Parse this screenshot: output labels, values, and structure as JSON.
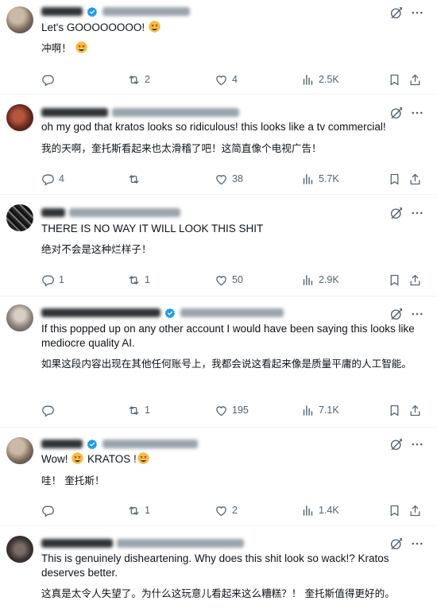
{
  "replies": [
    {
      "text_en": "Let's GOOOOOOOO! ",
      "text_zh": "冲啊！ ",
      "emoji": [
        "star-struck"
      ],
      "reply_count": "",
      "repost_count": "2",
      "like_count": "4",
      "view_count": "2.5K"
    },
    {
      "text_en": "oh my god that kratos looks so ridiculous! this looks like a tv commercial!",
      "text_zh": "我的天啊，奎托斯看起来也太滑稽了吧！这简直像个电视广告！",
      "reply_count": "4",
      "repost_count": "",
      "like_count": "38",
      "view_count": "5.7K"
    },
    {
      "text_en": "THERE IS NO WAY IT WILL LOOK THIS SHIT",
      "text_zh": "绝对不会是这种烂样子！",
      "reply_count": "1",
      "repost_count": "1",
      "like_count": "50",
      "view_count": "2.9K"
    },
    {
      "text_en": "If this popped up on any other account I would have been saying this looks like mediocre quality AI.",
      "text_zh": "如果这段内容出现在其他任何账号上，我都会说这看起来像是质量平庸的人工智能。",
      "reply_count": "",
      "repost_count": "1",
      "like_count": "195",
      "view_count": "7.1K"
    },
    {
      "text_en_a": "Wow! ",
      "text_en_b": " KRATOS !",
      "text_zh": "哇！ 奎托斯！",
      "reply_count": "",
      "repost_count": "1",
      "like_count": "2",
      "view_count": "1.4K"
    },
    {
      "text_en": "This is genuinely disheartening. Why does this shit look so wack!? Kratos deserves better.",
      "text_zh": "这真是太令人失望了。为什么这玩意儿看起来这么糟糕？！ 奎托斯值得更好的。"
    }
  ],
  "colors": {
    "text": "#0f1419",
    "muted": "#536471",
    "verified": "#1d9bf0",
    "divider": "#eff3f4"
  },
  "icons": [
    "reply-icon",
    "repost-icon",
    "like-icon",
    "views-icon",
    "bookmark-icon",
    "share-icon",
    "grok-icon",
    "more-icon",
    "verified-badge-icon",
    "star-struck-emoji"
  ]
}
